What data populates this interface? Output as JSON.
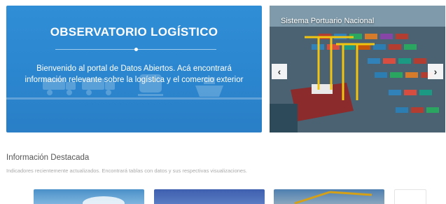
{
  "hero": {
    "title": "OBSERVATORIO LOGÍSTICO",
    "description": "Bienvenido al portal de Datos Abiertos. Acá encontrará información relevante sobre la logística y el comercio exterior",
    "icons": [
      "truck-icon",
      "truck-icon",
      "train-icon",
      "ship-icon"
    ],
    "background_color": "#2b86cf"
  },
  "carousel": {
    "slide_title": "Sistema Portuario Nacional",
    "prev_icon": "chevron-left-icon",
    "next_icon": "chevron-right-icon"
  },
  "featured": {
    "title": "Información Destacada",
    "description": "Indicadores recientemente actualizados. Encontrará tablas con datos y sus respectivas visualizaciones."
  }
}
